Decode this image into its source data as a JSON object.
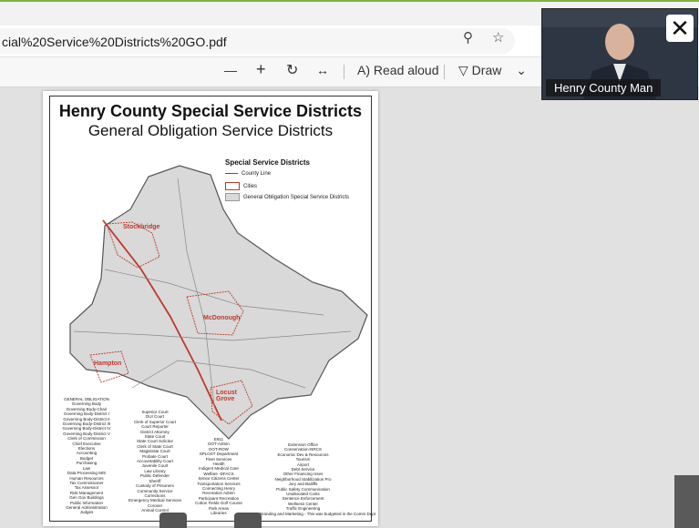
{
  "browser": {
    "url_fragment": "cial%20Service%20Districts%20GO.pdf",
    "zoom_icon": "zoom-icon",
    "favorite_icon": "star-icon"
  },
  "pdf_toolbar": {
    "zoom_out": "—",
    "zoom_in": "+",
    "rotate_icon": "rotate-icon",
    "fit_icon": "fit-page-icon",
    "read_aloud_label": "Read aloud",
    "draw_label": "Draw"
  },
  "map": {
    "title": "Henry County Special Service Districts",
    "subtitle": "General Obligation Service Districts",
    "legend": {
      "title": "Special Service Districts",
      "items": [
        "County Line",
        "Cities",
        "General Obligation Special Service Districts"
      ],
      "colors": {
        "county_line": "#555555",
        "cities": "#c0392b",
        "districts": "#d9d9d9"
      }
    },
    "cities": [
      "Stockbridge",
      "McDonough",
      "Hampton",
      "Locust Grove"
    ],
    "departments": {
      "col1": [
        "GENERAL OBLIGATION",
        "Governing Body",
        "Governing Body-Chair",
        "Governing Body-District I",
        "Governing Body-District II",
        "Governing Body-District III",
        "Governing Body-District IV",
        "Governing Body-District V",
        "Clerk of Commission",
        "Chief Executive",
        "Elections",
        "Accounting",
        "Budget",
        "Purchasing",
        "Law",
        "Data Processing MIS",
        "Human Resources",
        "Tax Commissioner",
        "Tax Assessor",
        "Risk Management",
        "Gen Gov Buildings",
        "Public Information",
        "General Administration",
        "Judges"
      ],
      "col2": [
        "Superior Court",
        "DUI Court",
        "Clerk of Superior Court",
        "Court Reporter",
        "District Attorney",
        "State Court",
        "State Court Solicitor",
        "Clerk of State Court",
        "Magistrate Court",
        "Probate Court",
        "Accountability Court",
        "Juvenile Court",
        "Law Library",
        "Public Defender",
        "Sheriff",
        "Custody of Prisoners",
        "Community Service",
        "Corrections",
        "Emergency Medical Services",
        "Coroner",
        "Animal Control"
      ],
      "col3": [
        "E911",
        "DOT-Admin",
        "DOT-ROW",
        "SPLOST Department",
        "Fleet Services",
        "Health",
        "Indigent Medical Care",
        "Welfare -DFACS",
        "Senior Citizens Center",
        "Transportation Services",
        "Connecting Henry",
        "Recreation Admin",
        "Participant Recreation",
        "Cotton Fields Golf Course",
        "Park Areas",
        "Libraries"
      ],
      "col4": [
        "Extension Office",
        "Conservation-NRCS",
        "Economic Dev & Resources",
        "Tourism",
        "Airport",
        "Debt Service",
        "Other Financing Uses",
        "Neighborhood Stabilization Pro",
        "Jury and Bailiffs",
        "Public Safety Communication",
        "Unallocated Costs",
        "Sentence Enforcement",
        "Wellness Center",
        "Traffic Engineering",
        "Branding and Marketing - This was budgeted in the Comm Dept"
      ]
    }
  },
  "video": {
    "participant_name": "Henry County Man",
    "close_label": "✕"
  }
}
